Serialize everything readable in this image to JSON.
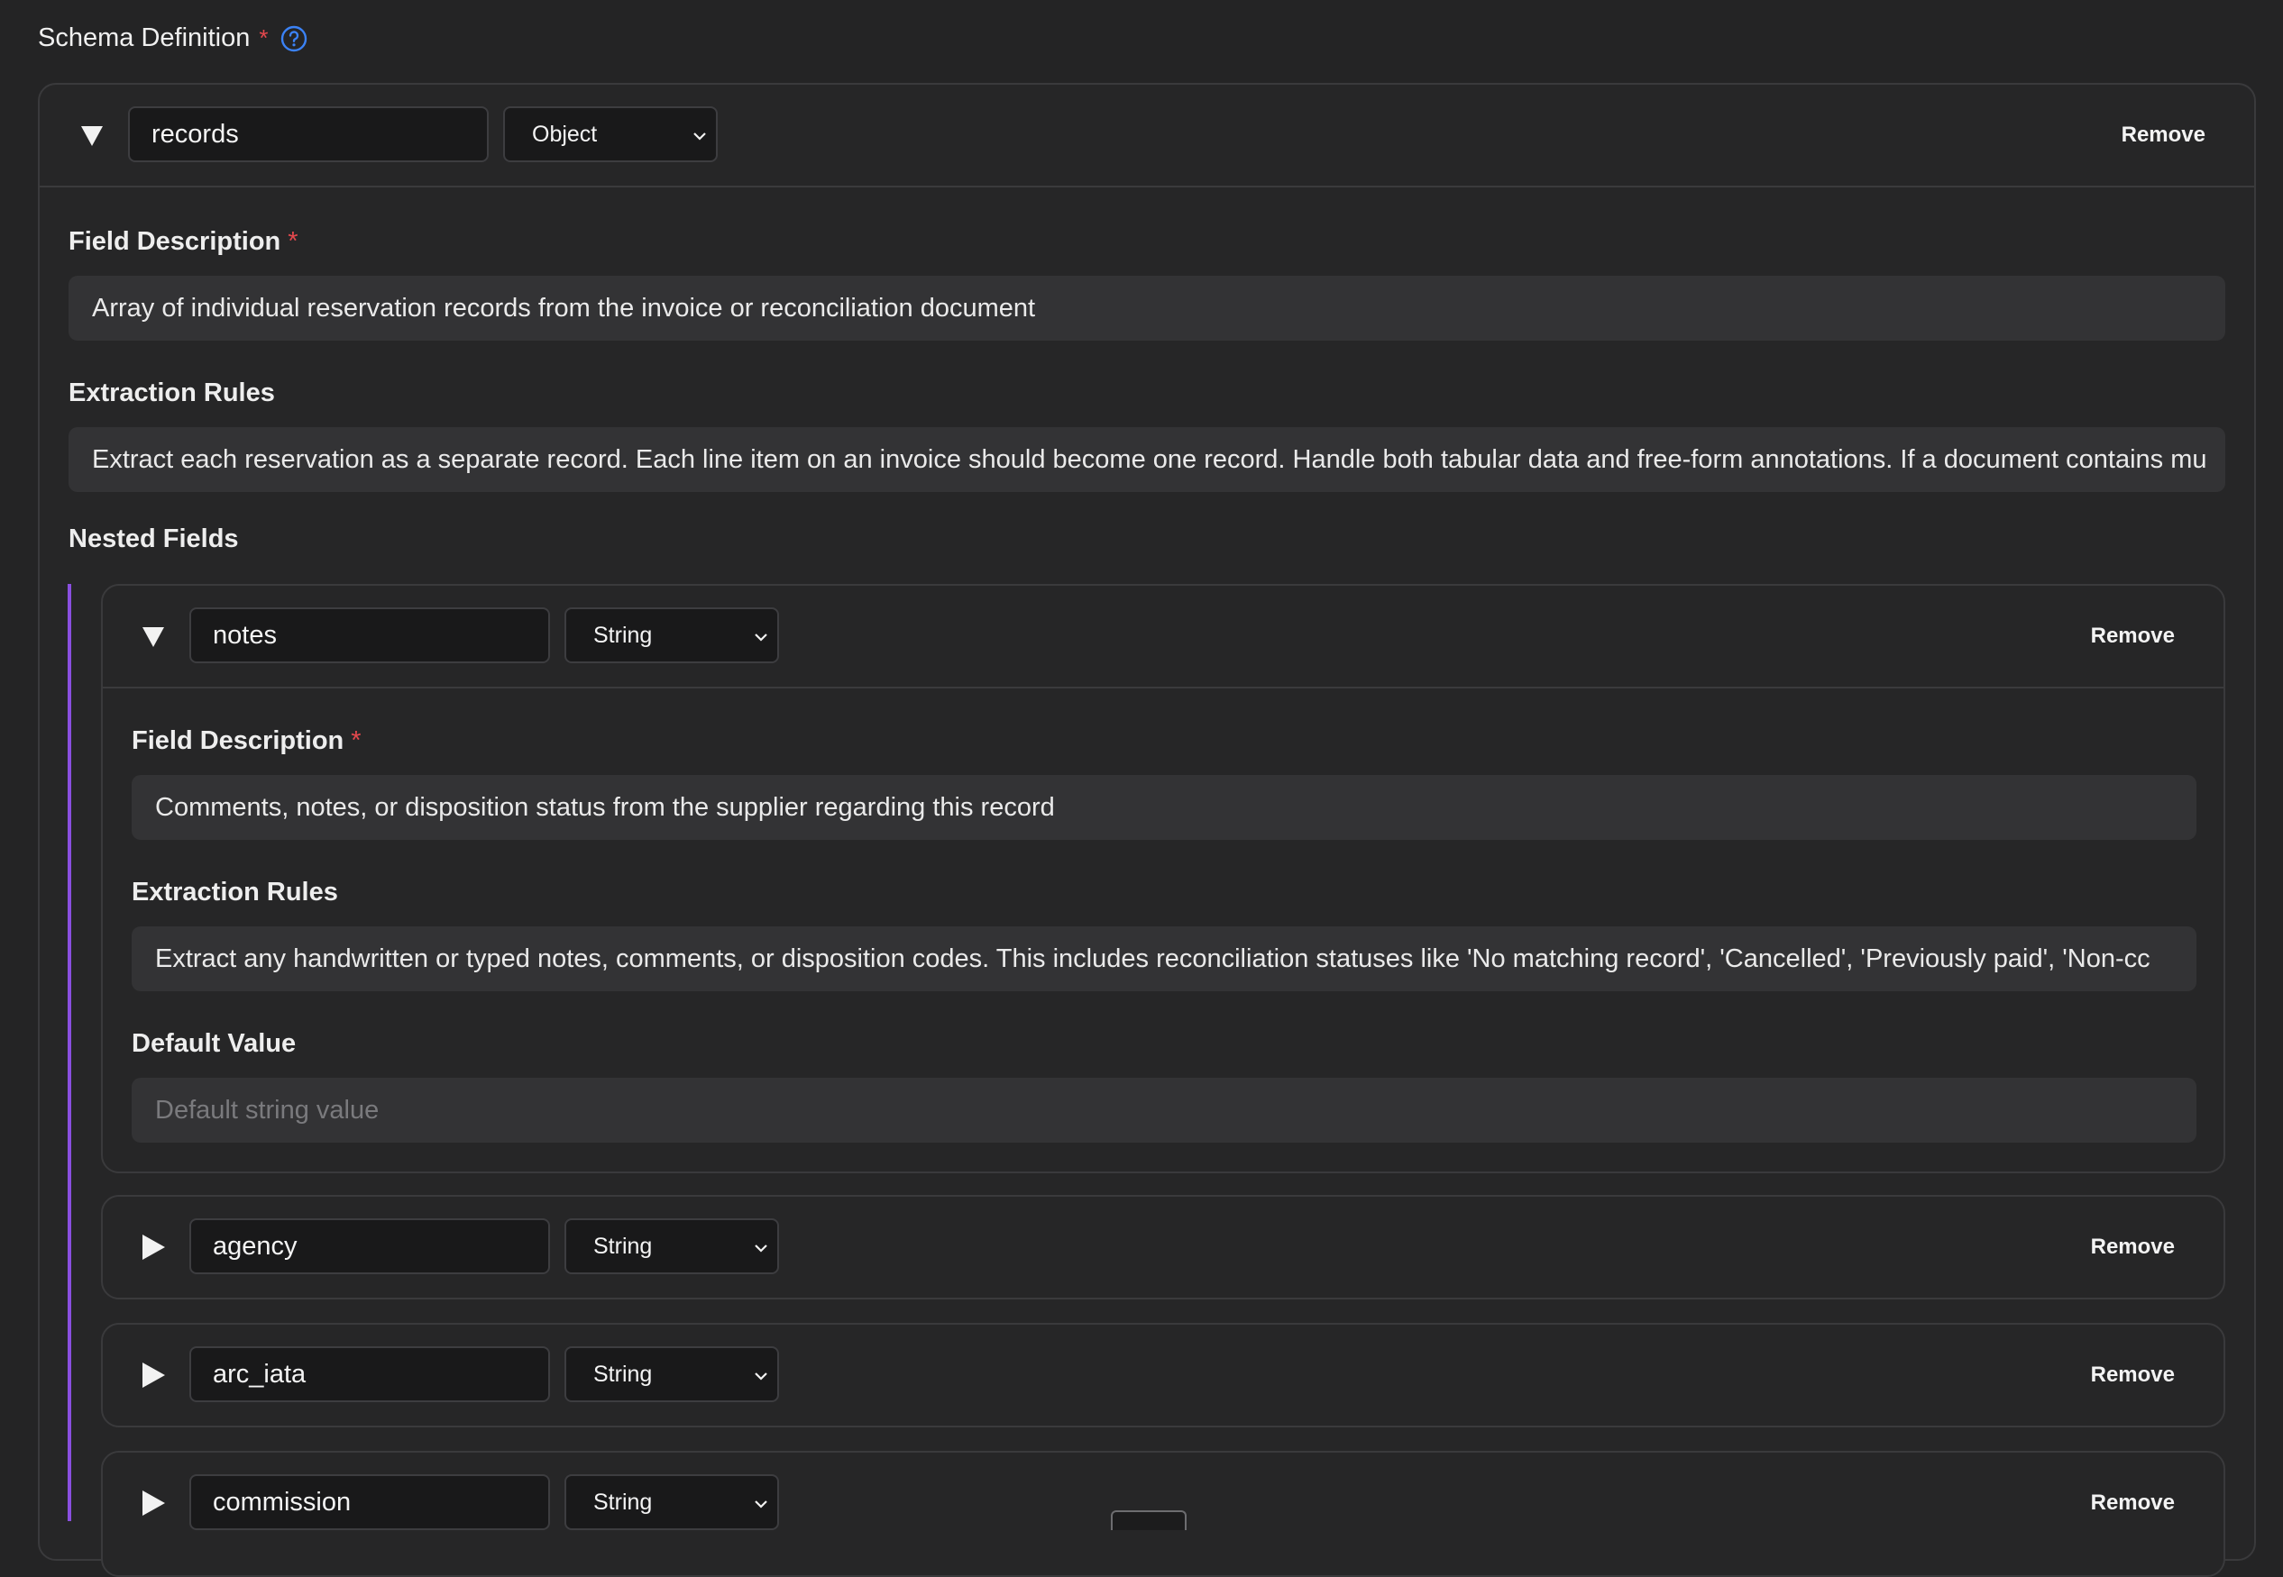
{
  "section": {
    "title": "Schema Definition",
    "required_mark": "*",
    "help_icon": "question-circle-icon"
  },
  "root_field": {
    "name": "records",
    "type": "Object",
    "remove_label": "Remove",
    "expanded": true,
    "description_label": "Field Description",
    "description_required": "*",
    "description": "Array of individual reservation records from the invoice or reconciliation document",
    "rules_label": "Extraction Rules",
    "rules": "Extract each reservation as a separate record. Each line item on an invoice should become one record. Handle both tabular data and free-form annotations. If a document contains mu",
    "nested_label": "Nested Fields"
  },
  "nested_fields": [
    {
      "name": "notes",
      "type": "String",
      "remove_label": "Remove",
      "expanded": true,
      "description_label": "Field Description",
      "description_required": "*",
      "description": "Comments, notes, or disposition status from the supplier regarding this record",
      "rules_label": "Extraction Rules",
      "rules": "Extract any handwritten or typed notes, comments, or disposition codes. This includes reconciliation statuses like 'No matching record', 'Cancelled', 'Previously paid', 'Non-cc",
      "default_label": "Default Value",
      "default_placeholder": "Default string value"
    },
    {
      "name": "agency",
      "type": "String",
      "remove_label": "Remove",
      "expanded": false
    },
    {
      "name": "arc_iata",
      "type": "String",
      "remove_label": "Remove",
      "expanded": false
    },
    {
      "name": "commission",
      "type": "String",
      "remove_label": "Remove",
      "expanded": false
    }
  ],
  "colors": {
    "background": "#242425",
    "required": "#e5484d",
    "accent_help": "#3b82f6",
    "nested_bar": "#8a4fe0"
  }
}
